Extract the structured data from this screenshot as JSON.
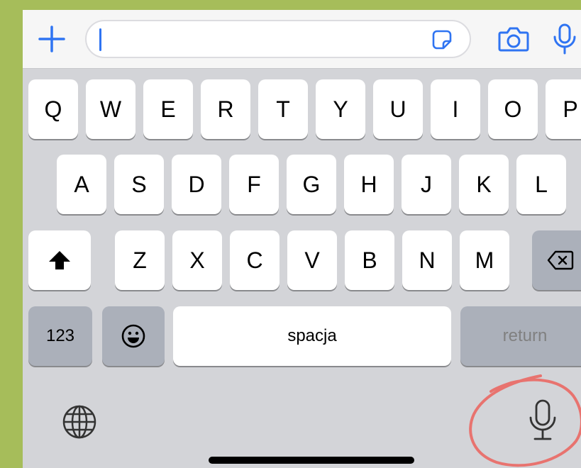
{
  "composer": {
    "icons": {
      "add": "plus-icon",
      "sticker": "sticker-icon",
      "camera": "camera-icon",
      "voice": "microphone-icon"
    },
    "message_value": "",
    "accent_color": "#2f74f2"
  },
  "keyboard": {
    "row1": [
      "Q",
      "W",
      "E",
      "R",
      "T",
      "Y",
      "U",
      "I",
      "O",
      "P"
    ],
    "row2": [
      "A",
      "S",
      "D",
      "F",
      "G",
      "H",
      "J",
      "K",
      "L"
    ],
    "row3": [
      "Z",
      "X",
      "C",
      "V",
      "B",
      "N",
      "M"
    ],
    "numbers_label": "123",
    "space_label": "spacja",
    "return_label": "return",
    "icons": {
      "shift": "shift-icon",
      "delete": "backspace-icon",
      "emoji": "emoji-icon",
      "globe": "globe-icon",
      "dictation": "microphone-icon"
    }
  },
  "annotation": {
    "color": "#e8736f",
    "target": "dictation microphone"
  }
}
